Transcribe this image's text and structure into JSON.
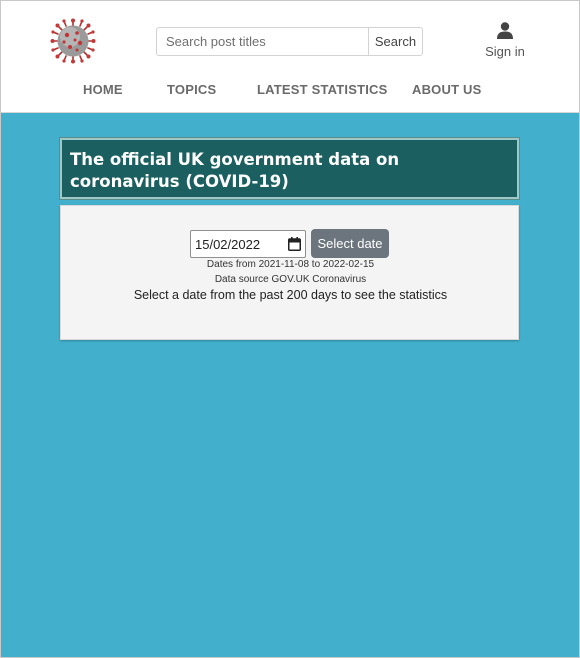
{
  "header": {
    "search": {
      "placeholder": "Search post titles",
      "value": "",
      "button_label": "Search"
    },
    "signin_label": "Sign in",
    "nav": [
      "HOME",
      "TOPICS",
      "LATEST STATISTICS",
      "ABOUT US"
    ]
  },
  "main": {
    "title": "The official UK government data on coronavirus (COVID-19)",
    "date_value": "15/02/2022",
    "select_button": "Select date",
    "date_range": "Dates from 2021-11-08 to 2022-02-15",
    "data_source": "Data source GOV.UK Coronavirus",
    "instruction": "Select a date from the past 200 days to see the statistics"
  },
  "colors": {
    "page_background": "#42b0cd",
    "title_background": "#1c5f60",
    "button_grey": "#6c757d"
  }
}
